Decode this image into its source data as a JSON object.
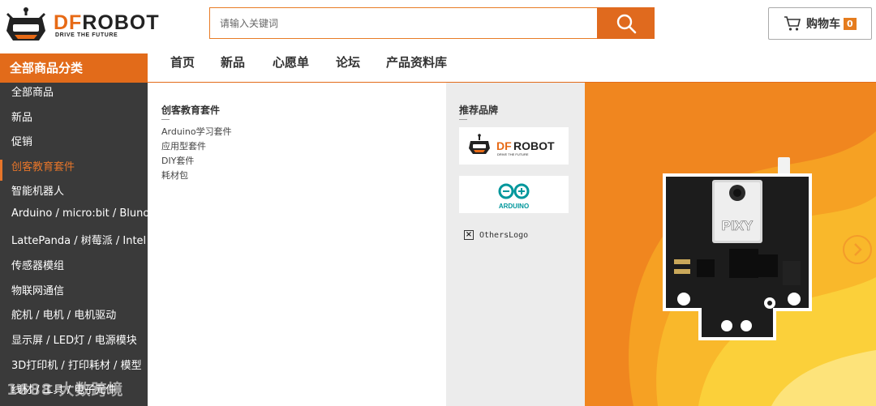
{
  "header": {
    "logo": {
      "name": "DFROBOT",
      "name_accent": "DF",
      "name_rest": "ROBOT",
      "tagline": "DRIVE THE FUTURE"
    },
    "search": {
      "placeholder": "请输入关键词",
      "value": "",
      "icon": "search-icon"
    },
    "cart": {
      "label": "购物车",
      "count": "0",
      "icon": "cart-icon"
    }
  },
  "nav": {
    "category_header": "全部商品分类",
    "links": [
      "首页",
      "新品",
      "心愿单",
      "论坛",
      "产品资料库"
    ]
  },
  "sidebar": {
    "items": [
      "全部商品",
      "新品",
      "促销",
      "创客教育套件",
      "智能机器人",
      "Arduino / micro:bit / Bluno",
      "LattePanda / 树莓派 / Intel",
      "传感器模组",
      "物联网通信",
      "舵机 / 电机 / 电机驱动",
      "显示屏 / LED灯 / 电源模块",
      "3D打印机 / 打印耗材 / 模型",
      "线材 / 工具 / 电子元件"
    ],
    "active_index": 3
  },
  "dropdown": {
    "title": "创客教育套件",
    "links": [
      "Arduino学习套件",
      "应用型套件",
      "DIY套件",
      "耗材包"
    ]
  },
  "brands": {
    "title": "推荐品牌",
    "items": [
      {
        "name": "DFROBOT",
        "tagline": "DRIVE THE FUTURE"
      },
      {
        "name": "ARDUINO"
      }
    ],
    "broken_image_alt": "OthersLogo"
  },
  "banner": {
    "product_label": "PIXY",
    "icon": "chevron-right-icon"
  },
  "watermark": "1688 大数跨境",
  "colors": {
    "accent": "#e26b1a",
    "sidebar_bg": "#3a3a3a",
    "brand_panel_bg": "#ececec",
    "arduino_teal": "#00979c"
  }
}
